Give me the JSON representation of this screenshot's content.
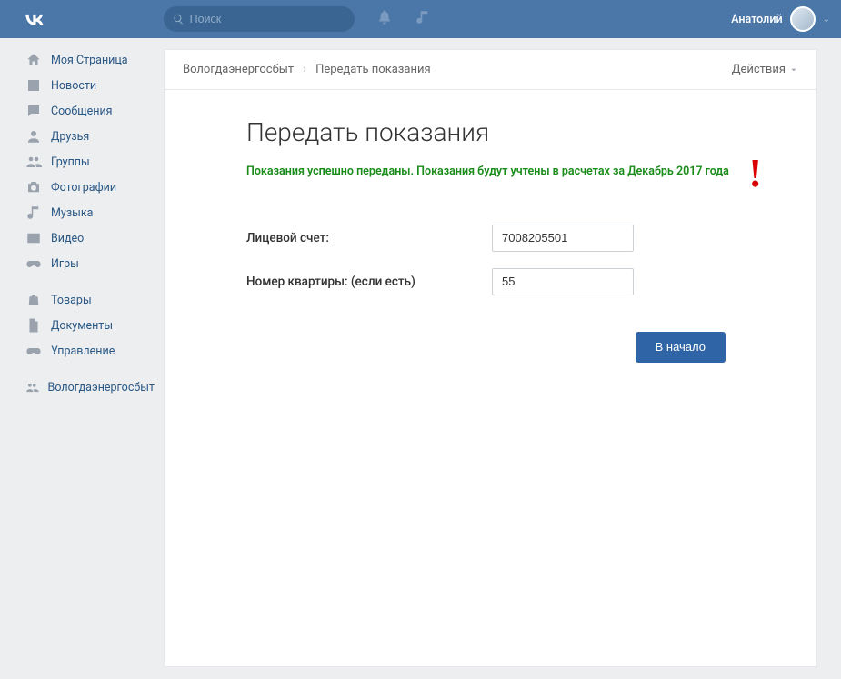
{
  "header": {
    "search_placeholder": "Поиск",
    "username": "Анатолий"
  },
  "sidebar": {
    "items": [
      {
        "label": "Моя Страница",
        "icon": "home"
      },
      {
        "label": "Новости",
        "icon": "newspaper"
      },
      {
        "label": "Сообщения",
        "icon": "message"
      },
      {
        "label": "Друзья",
        "icon": "user"
      },
      {
        "label": "Группы",
        "icon": "users"
      },
      {
        "label": "Фотографии",
        "icon": "camera"
      },
      {
        "label": "Музыка",
        "icon": "music"
      },
      {
        "label": "Видео",
        "icon": "video"
      },
      {
        "label": "Игры",
        "icon": "gamepad"
      }
    ],
    "items2": [
      {
        "label": "Товары",
        "icon": "bag"
      },
      {
        "label": "Документы",
        "icon": "doc"
      },
      {
        "label": "Управление",
        "icon": "gamepad"
      }
    ],
    "items3": [
      {
        "label": "Вологдаэнергосбыт",
        "icon": "users"
      }
    ]
  },
  "panel": {
    "breadcrumb_app": "Вологдаэнергосбыт",
    "breadcrumb_page": "Передать показания",
    "actions_label": "Действия"
  },
  "content": {
    "page_title": "Передать показания",
    "success_msg": "Показания успешно переданы. Показания будут учтены в расчетах за Декабрь 2017 года",
    "account_label": "Лицевой счет:",
    "account_value": "7008205501",
    "apt_label": "Номер квартиры: (если есть)",
    "apt_value": "55",
    "btn_start": "В начало"
  }
}
